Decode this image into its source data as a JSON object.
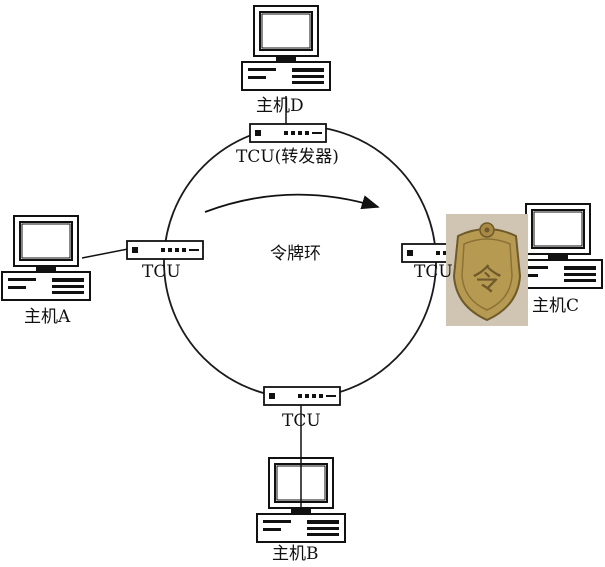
{
  "diagram": {
    "ring_label": "令牌环",
    "hosts": {
      "a": {
        "label": "主机A",
        "tcu_label": "TCU"
      },
      "b": {
        "label": "主机B",
        "tcu_label": "TCU"
      },
      "c": {
        "label": "主机C",
        "tcu_label": "TCU"
      },
      "d": {
        "label": "主机D",
        "tcu_label": "TCU(转发器)"
      }
    },
    "token_badge": {
      "text": "令",
      "icon": "token-medallion-icon"
    },
    "colors": {
      "ring": "#1a1a1a",
      "badge_gold": "#b79a52",
      "badge_bg": "#cfc5b2"
    }
  }
}
